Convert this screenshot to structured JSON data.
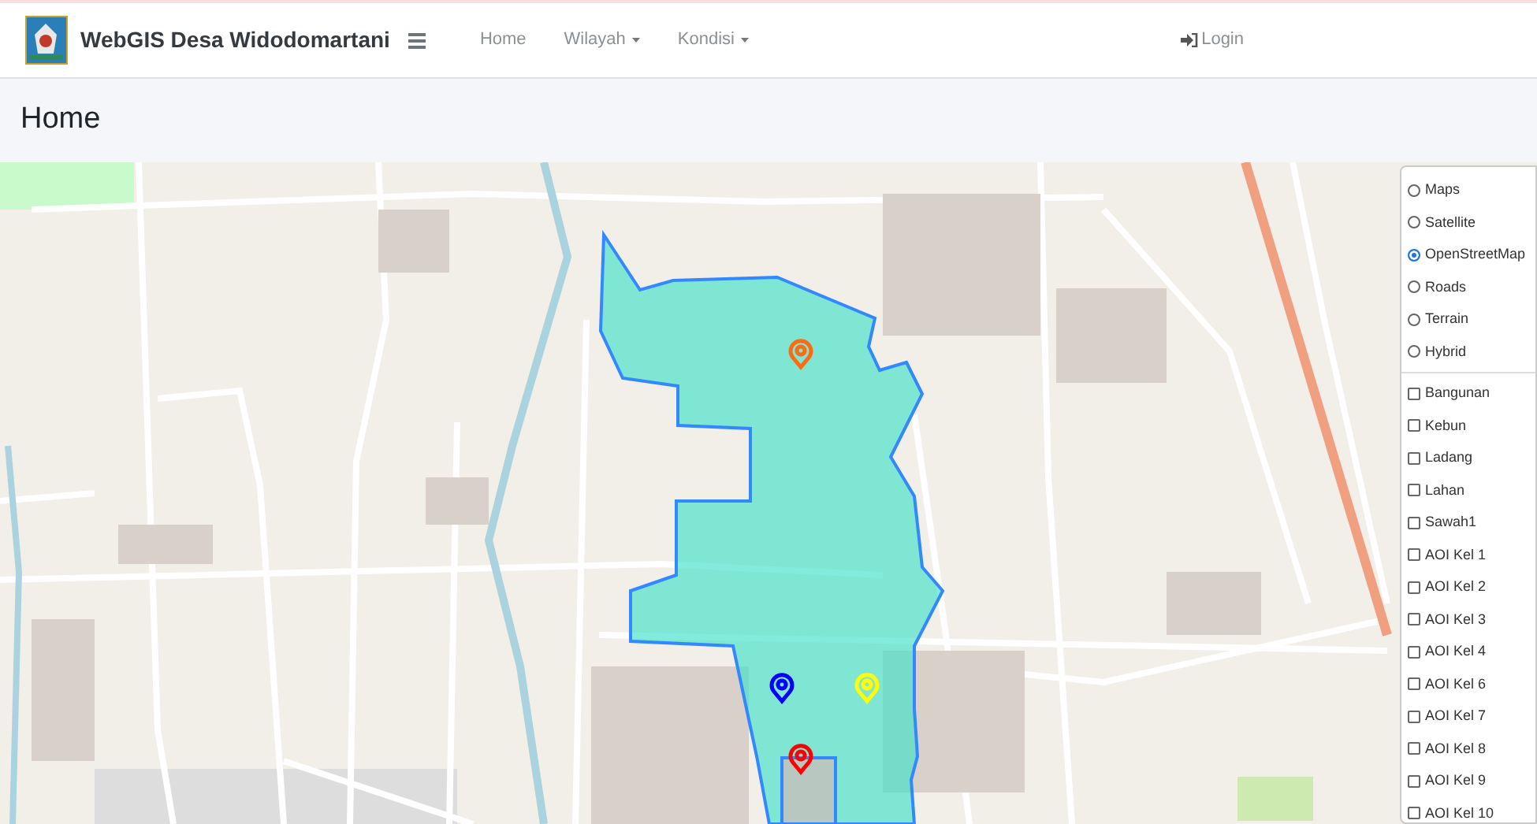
{
  "navbar": {
    "brand": "WebGIS Desa Widodomartani",
    "menu_items": [
      {
        "label": "Home",
        "dropdown": false
      },
      {
        "label": "Wilayah",
        "dropdown": true
      },
      {
        "label": "Kondisi",
        "dropdown": true
      }
    ],
    "login": "Login"
  },
  "page_header": {
    "title": "Home"
  },
  "map": {
    "markers": [
      {
        "color": "#ff6a13"
      },
      {
        "color": "#0000ff"
      },
      {
        "color": "#ffff00"
      },
      {
        "color": "#ff0000"
      }
    ],
    "base_layers": [
      {
        "label": "Maps",
        "selected": false
      },
      {
        "label": "Satellite",
        "selected": false
      },
      {
        "label": "OpenStreetMap",
        "selected": true
      },
      {
        "label": "Roads",
        "selected": false
      },
      {
        "label": "Terrain",
        "selected": false
      },
      {
        "label": "Hybrid",
        "selected": false
      }
    ],
    "overlays": [
      {
        "label": "Bangunan",
        "checked": false
      },
      {
        "label": "Kebun",
        "checked": false
      },
      {
        "label": "Ladang",
        "checked": false
      },
      {
        "label": "Lahan",
        "checked": false
      },
      {
        "label": "Sawah1",
        "checked": false
      },
      {
        "label": "AOI Kel 1",
        "checked": false
      },
      {
        "label": "AOI Kel 2",
        "checked": false
      },
      {
        "label": "AOI Kel 3",
        "checked": false
      },
      {
        "label": "AOI Kel 4",
        "checked": false
      },
      {
        "label": "AOI Kel 6",
        "checked": false
      },
      {
        "label": "AOI Kel 7",
        "checked": false
      },
      {
        "label": "AOI Kel 8",
        "checked": false
      },
      {
        "label": "AOI Kel 9",
        "checked": false
      },
      {
        "label": "AOI Kel 10",
        "checked": false
      }
    ]
  }
}
